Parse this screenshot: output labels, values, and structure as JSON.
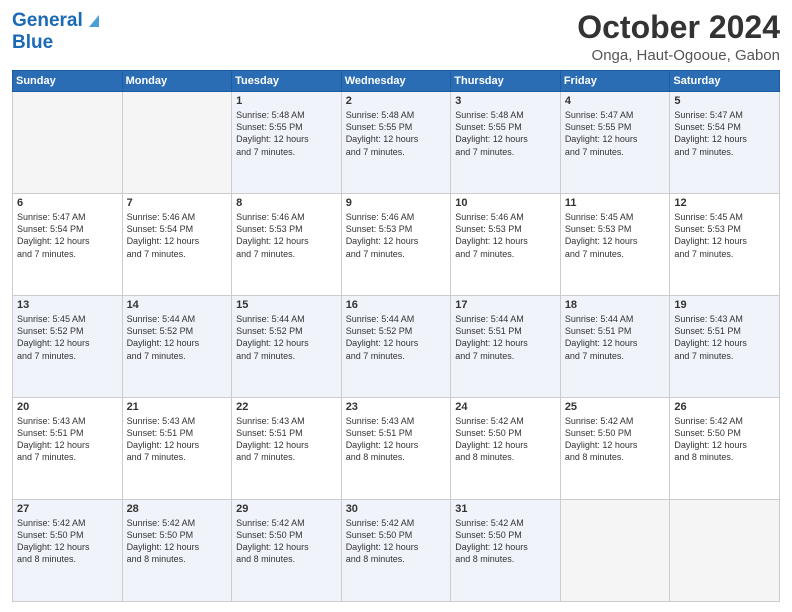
{
  "header": {
    "logo_line1": "General",
    "logo_line2": "Blue",
    "main_title": "October 2024",
    "subtitle": "Onga, Haut-Ogooue, Gabon"
  },
  "calendar": {
    "headers": [
      "Sunday",
      "Monday",
      "Tuesday",
      "Wednesday",
      "Thursday",
      "Friday",
      "Saturday"
    ],
    "rows": [
      [
        {
          "day": "",
          "info": ""
        },
        {
          "day": "",
          "info": ""
        },
        {
          "day": "1",
          "info": "Sunrise: 5:48 AM\nSunset: 5:55 PM\nDaylight: 12 hours\nand 7 minutes."
        },
        {
          "day": "2",
          "info": "Sunrise: 5:48 AM\nSunset: 5:55 PM\nDaylight: 12 hours\nand 7 minutes."
        },
        {
          "day": "3",
          "info": "Sunrise: 5:48 AM\nSunset: 5:55 PM\nDaylight: 12 hours\nand 7 minutes."
        },
        {
          "day": "4",
          "info": "Sunrise: 5:47 AM\nSunset: 5:55 PM\nDaylight: 12 hours\nand 7 minutes."
        },
        {
          "day": "5",
          "info": "Sunrise: 5:47 AM\nSunset: 5:54 PM\nDaylight: 12 hours\nand 7 minutes."
        }
      ],
      [
        {
          "day": "6",
          "info": "Sunrise: 5:47 AM\nSunset: 5:54 PM\nDaylight: 12 hours\nand 7 minutes."
        },
        {
          "day": "7",
          "info": "Sunrise: 5:46 AM\nSunset: 5:54 PM\nDaylight: 12 hours\nand 7 minutes."
        },
        {
          "day": "8",
          "info": "Sunrise: 5:46 AM\nSunset: 5:53 PM\nDaylight: 12 hours\nand 7 minutes."
        },
        {
          "day": "9",
          "info": "Sunrise: 5:46 AM\nSunset: 5:53 PM\nDaylight: 12 hours\nand 7 minutes."
        },
        {
          "day": "10",
          "info": "Sunrise: 5:46 AM\nSunset: 5:53 PM\nDaylight: 12 hours\nand 7 minutes."
        },
        {
          "day": "11",
          "info": "Sunrise: 5:45 AM\nSunset: 5:53 PM\nDaylight: 12 hours\nand 7 minutes."
        },
        {
          "day": "12",
          "info": "Sunrise: 5:45 AM\nSunset: 5:53 PM\nDaylight: 12 hours\nand 7 minutes."
        }
      ],
      [
        {
          "day": "13",
          "info": "Sunrise: 5:45 AM\nSunset: 5:52 PM\nDaylight: 12 hours\nand 7 minutes."
        },
        {
          "day": "14",
          "info": "Sunrise: 5:44 AM\nSunset: 5:52 PM\nDaylight: 12 hours\nand 7 minutes."
        },
        {
          "day": "15",
          "info": "Sunrise: 5:44 AM\nSunset: 5:52 PM\nDaylight: 12 hours\nand 7 minutes."
        },
        {
          "day": "16",
          "info": "Sunrise: 5:44 AM\nSunset: 5:52 PM\nDaylight: 12 hours\nand 7 minutes."
        },
        {
          "day": "17",
          "info": "Sunrise: 5:44 AM\nSunset: 5:51 PM\nDaylight: 12 hours\nand 7 minutes."
        },
        {
          "day": "18",
          "info": "Sunrise: 5:44 AM\nSunset: 5:51 PM\nDaylight: 12 hours\nand 7 minutes."
        },
        {
          "day": "19",
          "info": "Sunrise: 5:43 AM\nSunset: 5:51 PM\nDaylight: 12 hours\nand 7 minutes."
        }
      ],
      [
        {
          "day": "20",
          "info": "Sunrise: 5:43 AM\nSunset: 5:51 PM\nDaylight: 12 hours\nand 7 minutes."
        },
        {
          "day": "21",
          "info": "Sunrise: 5:43 AM\nSunset: 5:51 PM\nDaylight: 12 hours\nand 7 minutes."
        },
        {
          "day": "22",
          "info": "Sunrise: 5:43 AM\nSunset: 5:51 PM\nDaylight: 12 hours\nand 7 minutes."
        },
        {
          "day": "23",
          "info": "Sunrise: 5:43 AM\nSunset: 5:51 PM\nDaylight: 12 hours\nand 8 minutes."
        },
        {
          "day": "24",
          "info": "Sunrise: 5:42 AM\nSunset: 5:50 PM\nDaylight: 12 hours\nand 8 minutes."
        },
        {
          "day": "25",
          "info": "Sunrise: 5:42 AM\nSunset: 5:50 PM\nDaylight: 12 hours\nand 8 minutes."
        },
        {
          "day": "26",
          "info": "Sunrise: 5:42 AM\nSunset: 5:50 PM\nDaylight: 12 hours\nand 8 minutes."
        }
      ],
      [
        {
          "day": "27",
          "info": "Sunrise: 5:42 AM\nSunset: 5:50 PM\nDaylight: 12 hours\nand 8 minutes."
        },
        {
          "day": "28",
          "info": "Sunrise: 5:42 AM\nSunset: 5:50 PM\nDaylight: 12 hours\nand 8 minutes."
        },
        {
          "day": "29",
          "info": "Sunrise: 5:42 AM\nSunset: 5:50 PM\nDaylight: 12 hours\nand 8 minutes."
        },
        {
          "day": "30",
          "info": "Sunrise: 5:42 AM\nSunset: 5:50 PM\nDaylight: 12 hours\nand 8 minutes."
        },
        {
          "day": "31",
          "info": "Sunrise: 5:42 AM\nSunset: 5:50 PM\nDaylight: 12 hours\nand 8 minutes."
        },
        {
          "day": "",
          "info": ""
        },
        {
          "day": "",
          "info": ""
        }
      ]
    ]
  }
}
